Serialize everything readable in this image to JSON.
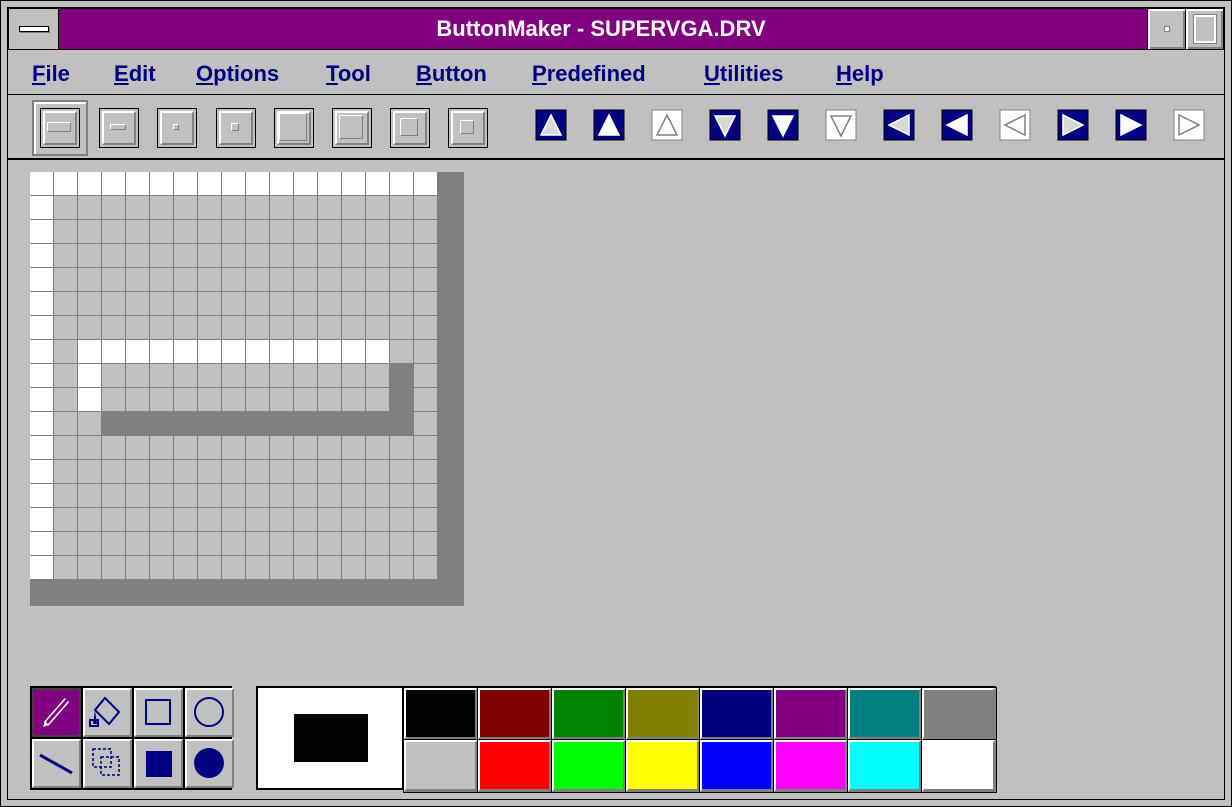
{
  "window": {
    "title": "ButtonMaker - SUPERVGA.DRV"
  },
  "menu": [
    {
      "key": "F",
      "rest": "ile"
    },
    {
      "key": "E",
      "rest": "dit"
    },
    {
      "key": "O",
      "rest": "ptions"
    },
    {
      "key": "T",
      "rest": "ool"
    },
    {
      "key": "B",
      "rest": "utton"
    },
    {
      "key": "P",
      "rest": "redefined"
    },
    {
      "key": "U",
      "rest": "tilities"
    },
    {
      "key": "H",
      "rest": "elp"
    }
  ],
  "toolbar": {
    "selected_index": 0,
    "buttons": [
      "horizontal-bar-large",
      "horizontal-bar-small",
      "dot-small",
      "dot-medium",
      "square-large",
      "square-medium",
      "square-small",
      "square-tiny",
      "arrow-up-filled",
      "arrow-up-filled-2",
      "arrow-up-outline",
      "arrow-down-filled",
      "arrow-down-filled-2",
      "arrow-down-outline",
      "arrow-left-filled",
      "arrow-left-filled-2",
      "arrow-left-outline",
      "arrow-right-filled",
      "arrow-right-filled-2",
      "arrow-right-outline"
    ]
  },
  "editor_grid": {
    "size": 17,
    "white_cells": "row0:0-16;col0:1-16;row7:2-14;col2:8-9",
    "gray_cells": "col15:8-10;row10:3-15"
  },
  "tools": [
    {
      "name": "pencil-icon",
      "selected": true
    },
    {
      "name": "fill-bucket-icon",
      "selected": false
    },
    {
      "name": "rectangle-outline-icon",
      "selected": false
    },
    {
      "name": "ellipse-outline-icon",
      "selected": false
    },
    {
      "name": "line-icon",
      "selected": false
    },
    {
      "name": "selection-icon",
      "selected": false
    },
    {
      "name": "rectangle-filled-icon",
      "selected": false
    },
    {
      "name": "ellipse-filled-icon",
      "selected": false
    }
  ],
  "colors": {
    "foreground": "#000000",
    "background": "#ffffff",
    "palette": [
      "#000000",
      "#800000",
      "#008000",
      "#808000",
      "#000080",
      "#800080",
      "#008080",
      "#808080",
      "#c0c0c0",
      "#ff0000",
      "#00ff00",
      "#ffff00",
      "#0000ff",
      "#ff00ff",
      "#00ffff",
      "#ffffff"
    ],
    "accent_titlebar": "#800080",
    "menu_text": "#000080"
  }
}
